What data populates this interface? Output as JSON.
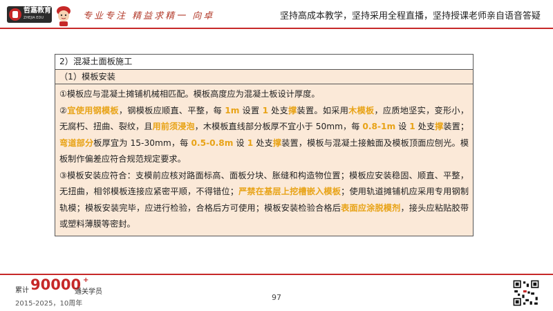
{
  "header": {
    "logo_text": "哲嘉教育",
    "logo_subtext": "ZHEJIA EDU",
    "handwritten_slogan": "专业专注  精益求精一 向卓",
    "tagline": "坚持高成本教学，坚持采用全程直播，坚持授课老师亲自语音答疑"
  },
  "content": {
    "section_title": "2）混凝土面板施工",
    "subsection_title": "（1）模板安装",
    "para1": "①模板应与混凝土摊铺机械相匹配。模板高度应为混凝土板设计厚度。",
    "para2": {
      "p01": "②",
      "p02": "宜使用钢模板",
      "p03": "，钢模板应顺直、平整，每 ",
      "p04": "1m",
      "p05": " 设置 ",
      "p06": "1",
      "p07": " 处支",
      "p08": "撑",
      "p09": "装置。如采用",
      "p10": "木模板",
      "p11": "，应质地坚实，变形小，无腐朽、扭曲、裂纹，且",
      "p12": "用前须浸泡",
      "p13": "，木模板直线部分板厚不宜小于 50mm，每 ",
      "p14": "0.8-1m",
      "p15": " 设 ",
      "p16": "1",
      "p17": " 处支",
      "p18": "撑",
      "p19": "装置；",
      "p20": "弯道部分",
      "p21": "板厚宜为 15-30mm，每 ",
      "p22": "0.5-0.8m",
      "p23": " 设 ",
      "p24": "1",
      "p25": " 处支",
      "p26": "撑",
      "p27": "装置，模板与混凝土接触面及模板顶面应刨光。模板制作偏差应符合规范规定要求。"
    },
    "para3": {
      "p1": "③模板安装应符合：支模前应核对路面标高、面板分块、胀缝和构造物位置；模板应安装稳固、顺直、平整，无扭曲，相邻模板连接应紧密平顺，不得错位；",
      "p2": "严禁在基层上挖槽嵌入模板",
      "p3": "；使用轨道摊铺机应采用专用钢制轨模；模板安装完毕，应进行检验，合格后方可使用；模板安装检验合格后",
      "p4": "表面应涂脱模剂",
      "p5": "，接头应粘贴胶带或塑料薄膜等密封。"
    }
  },
  "footer": {
    "stat_label": "累计",
    "stat_number": "90000",
    "stat_plus": "+",
    "stat_suffix": "通关学员",
    "years": "2015-2025，10周年",
    "page_number": "97"
  },
  "colors": {
    "brand_red": "#c62828",
    "highlight": "#e8a317",
    "row_fill": "#fbe9d8"
  }
}
